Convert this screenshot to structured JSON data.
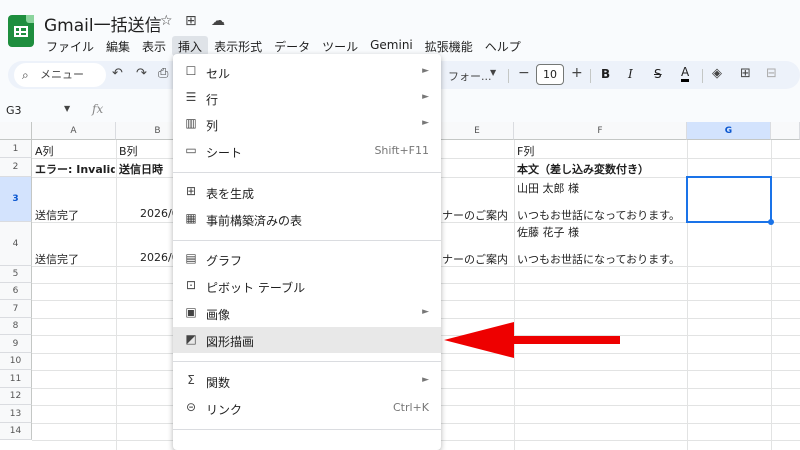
{
  "app": {
    "title": "Gmail一括送信",
    "star_icon": "☆",
    "folder_icon": "⊞",
    "cloud_icon": "☁"
  },
  "menubar": [
    "ファイル",
    "編集",
    "表示",
    "挿入",
    "表示形式",
    "データ",
    "ツール",
    "Gemini",
    "拡張機能",
    "ヘルプ"
  ],
  "toolbar": {
    "search_label": "メニュー",
    "font_label": "フォー...",
    "font_size": "10",
    "bold": "B",
    "italic": "I",
    "strike": "S",
    "text_color": "A"
  },
  "formula_bar": {
    "name_box": "G3",
    "fx": "fx"
  },
  "columns": [
    "A",
    "B",
    "C",
    "D",
    "E",
    "F",
    "G"
  ],
  "selected_column": "G",
  "rows": [
    "1",
    "2",
    "3",
    "4",
    "5",
    "6",
    "7",
    "8",
    "9",
    "10",
    "11",
    "12",
    "13",
    "14"
  ],
  "selected_row": "3",
  "cells": {
    "A1": "A列",
    "B1": "B列",
    "F1": "F列",
    "A2": "エラー: Invalid e",
    "B2": "送信日時",
    "F2": "本文（差し込み変数付き）",
    "F3a": "山田 太郎 様",
    "F3b": "いつもお世話になっております。",
    "A3": "送信完了",
    "B3": "2026/0",
    "E3": "ナーのご案内",
    "F4a": "佐藤 花子 様",
    "F4b": "いつもお世話になっております。",
    "A4": "送信完了",
    "B4": "2026/0",
    "E4": "ナーのご案内"
  },
  "insert_menu": {
    "items": [
      {
        "label": "セル",
        "icon": "☐",
        "submenu": true
      },
      {
        "label": "行",
        "icon": "☰",
        "submenu": true
      },
      {
        "label": "列",
        "icon": "▥",
        "submenu": true
      },
      {
        "label": "シート",
        "icon": "▭",
        "shortcut": "Shift+F11"
      },
      {
        "label": "表を生成",
        "icon": "⊞"
      },
      {
        "label": "事前構築済みの表",
        "icon": "▦"
      },
      {
        "label": "グラフ",
        "icon": "▤"
      },
      {
        "label": "ピボット テーブル",
        "icon": "⊡"
      },
      {
        "label": "画像",
        "icon": "▣",
        "submenu": true
      },
      {
        "label": "図形描画",
        "icon": "◩",
        "highlighted": true
      },
      {
        "label": "関数",
        "icon": "Σ",
        "submenu": true
      },
      {
        "label": "リンク",
        "icon": "⊝",
        "shortcut": "Ctrl+K"
      }
    ]
  },
  "colors": {
    "accent": "#1a73e8",
    "arrow": "#ee0000",
    "logo": "#1e8e3e"
  }
}
